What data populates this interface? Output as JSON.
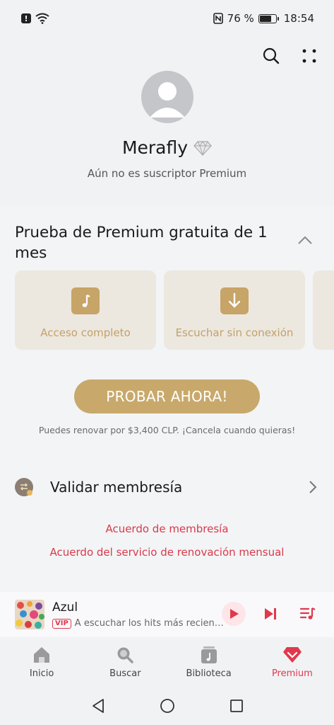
{
  "status_bar": {
    "battery_text": "76 %",
    "battery_level": 0.76,
    "time": "18:54"
  },
  "profile": {
    "username": "Merafly",
    "subscription_status": "Aún no es suscriptor Premium"
  },
  "trial": {
    "title": "Prueba de Premium gratuita de 1 mes",
    "benefits": [
      {
        "label": "Acceso completo",
        "icon": "music-note-icon"
      },
      {
        "label": "Escuchar sin conexión",
        "icon": "download-icon"
      }
    ],
    "cta_label": "PROBAR AHORA!",
    "renew_note": "Puedes renovar por $3,400 CLP. ¡Cancela cuando quieras!"
  },
  "validate": {
    "label": "Validar membresía"
  },
  "links": {
    "membership_agreement": "Acuerdo de membresía",
    "renewal_agreement": "Acuerdo del servicio de renovación mensual"
  },
  "player": {
    "title": "Azul",
    "badge": "VIP",
    "subtitle": "A escuchar los hits más recien…"
  },
  "tabs": [
    {
      "label": "Inicio",
      "icon": "home-icon"
    },
    {
      "label": "Buscar",
      "icon": "search-icon"
    },
    {
      "label": "Biblioteca",
      "icon": "library-icon"
    },
    {
      "label": "Premium",
      "icon": "premium-diamond-icon"
    }
  ],
  "colors": {
    "accent_red": "#e0394d",
    "gold": "#c8a96b",
    "card_bg": "#ece8df"
  }
}
